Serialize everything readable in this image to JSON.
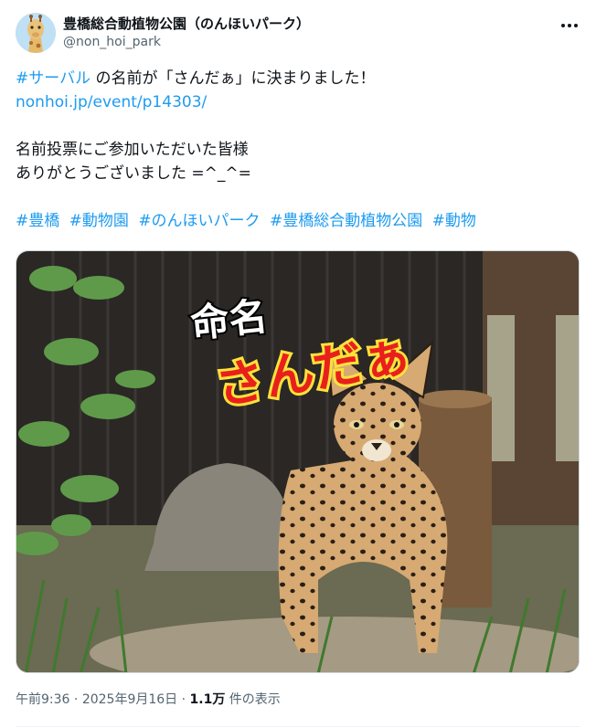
{
  "account": {
    "display_name": "豊橋総合動植物公園（のんほいパーク）",
    "handle": "@non_hoi_park"
  },
  "post": {
    "line1_hashtag": "#サーバル",
    "line1_text": " の名前が「さんだぁ」に決まりました！",
    "link": "nonhoi.jp/event/p14303/",
    "line3": "名前投票にご参加いただいた皆様",
    "line4": "ありがとうございました =^_^=",
    "hashtags": [
      "#豊橋",
      "#動物園",
      "#のんほいパーク",
      "#豊橋総合動植物公園",
      "#動物"
    ]
  },
  "media": {
    "overlay_title": "命名",
    "overlay_name": "さんだぁ"
  },
  "meta": {
    "time": "午前9:36",
    "sep1": " · ",
    "date": "2025年9月16日",
    "sep2": " · ",
    "views_count": "1.1万",
    "views_label": " 件の表示"
  },
  "colors": {
    "link": "#1d9bf0",
    "text": "#0f1419",
    "secondary": "#536471"
  },
  "icons": {
    "more": "more-horizontal-icon",
    "avatar": "giraffe-avatar"
  }
}
